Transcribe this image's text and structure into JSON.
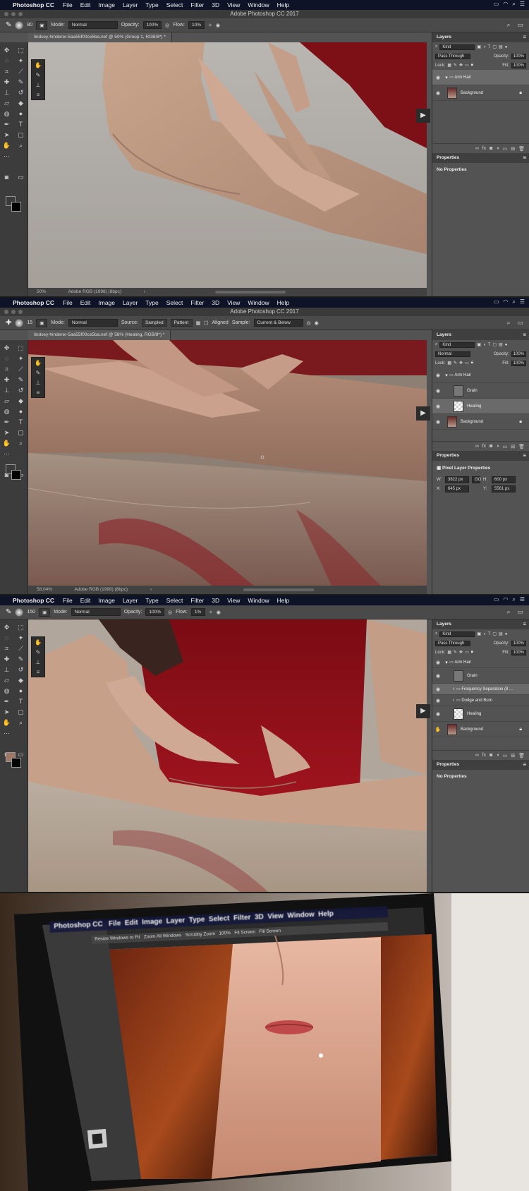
{
  "colors": {
    "menubar": "#0e1328",
    "panel": "#535353",
    "dark_ui": "#3c3c3c",
    "dress_red": "#8a1018",
    "skin": "#c09a82"
  },
  "menu": {
    "app_name": "Photoshop CC",
    "items": [
      "File",
      "Edit",
      "Image",
      "Layer",
      "Type",
      "Select",
      "Filter",
      "3D",
      "View",
      "Window",
      "Help"
    ]
  },
  "title": "Adobe Photoshop CC 2017",
  "screens": [
    {
      "doc_tab": "lindsey-hinderer-5aa55f00ce5ba.nef @ 50% (Group 1, RGB/8*) *",
      "options": {
        "mode_label": "Mode:",
        "mode": "Normal",
        "opacity_label": "Opacity:",
        "opacity": "100%",
        "flow_label": "Flow:",
        "flow": "10%",
        "brush_size": "80"
      },
      "status": {
        "zoom": "50%",
        "profile": "Adobe RGB (1998) (8bpc)"
      },
      "layers": {
        "title": "Layers",
        "kind": "Kind",
        "blend": "Pass Through",
        "opacity_label": "Opacity:",
        "opacity": "100%",
        "lock_label": "Lock:",
        "fill_label": "Fill:",
        "fill": "100%",
        "rows": [
          {
            "name": "Arm Hair",
            "type": "group"
          },
          {
            "name": "Background",
            "type": "image"
          }
        ]
      },
      "properties": {
        "title": "Properties",
        "text": "No Properties"
      }
    },
    {
      "doc_tab": "lindsey-hinderer-5aa55f00ce5ba.nef @ 58% (Healing, RGB/8*) *",
      "options": {
        "mode_label": "Mode:",
        "mode": "Normal",
        "source_label": "Source:",
        "sampled": "Sampled",
        "pattern": "Pattern",
        "aligned": "Aligned",
        "sample_label": "Sample:",
        "sample": "Current & Below",
        "brush_size": "15"
      },
      "status": {
        "zoom": "58.04%",
        "profile": "Adobe RGB (1998) (8bpc)"
      },
      "layers": {
        "title": "Layers",
        "kind": "Kind",
        "blend": "Normal",
        "opacity_label": "Opacity:",
        "opacity": "100%",
        "lock_label": "Lock:",
        "fill_label": "Fill:",
        "fill": "100%",
        "rows": [
          {
            "name": "Arm Hair",
            "type": "group"
          },
          {
            "name": "Grain",
            "type": "fill"
          },
          {
            "name": "Healing",
            "type": "empty"
          },
          {
            "name": "Background",
            "type": "image"
          }
        ]
      },
      "properties": {
        "title": "Properties",
        "text": "Pixel Layer Properties",
        "w_label": "W:",
        "w": "3822 px",
        "h_label": "H:",
        "h": "600 px",
        "x_label": "X:",
        "x": "645 px",
        "y_label": "Y:",
        "y": "5561 px",
        "link": "GO"
      }
    },
    {
      "options": {
        "mode_label": "Mode:",
        "mode": "Normal",
        "opacity_label": "Opacity:",
        "opacity": "100%",
        "flow_label": "Flow:",
        "flow": "1%",
        "brush_size": "150"
      },
      "layers": {
        "title": "Layers",
        "kind": "Kind",
        "blend": "Pass Through",
        "opacity_label": "Opacity:",
        "opacity": "100%",
        "lock_label": "Lock:",
        "fill_label": "Fill:",
        "fill": "100%",
        "rows": [
          {
            "name": "Arm Hair",
            "type": "group"
          },
          {
            "name": "Grain",
            "type": "fill"
          },
          {
            "name": "Frequency Separation (8 ...",
            "type": "subgroup"
          },
          {
            "name": "Dodge and Burn",
            "type": "subgroup"
          },
          {
            "name": "Healing",
            "type": "empty"
          },
          {
            "name": "Background",
            "type": "image"
          }
        ]
      },
      "properties": {
        "title": "Properties",
        "text": "No Properties"
      }
    }
  ],
  "laptop": {
    "app_name": "Photoshop CC",
    "items": [
      "File",
      "Edit",
      "Image",
      "Layer",
      "Type",
      "Select",
      "Filter",
      "3D",
      "View",
      "Window",
      "Help"
    ],
    "options": [
      "Resize Windows to Fit",
      "Zoom All Windows",
      "Scrubby Zoom",
      "100%",
      "Fit Screen",
      "Fill Screen"
    ]
  }
}
